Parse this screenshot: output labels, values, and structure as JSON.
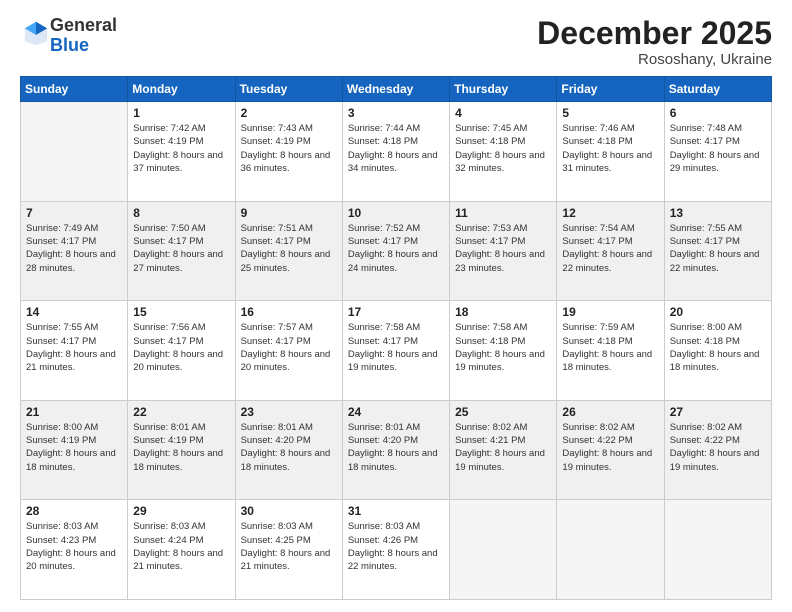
{
  "header": {
    "logo_general": "General",
    "logo_blue": "Blue",
    "month_title": "December 2025",
    "location": "Rososhany, Ukraine"
  },
  "calendar": {
    "days_of_week": [
      "Sunday",
      "Monday",
      "Tuesday",
      "Wednesday",
      "Thursday",
      "Friday",
      "Saturday"
    ],
    "weeks": [
      [
        {
          "day": "",
          "empty": true
        },
        {
          "day": "1",
          "sunrise": "7:42 AM",
          "sunset": "4:19 PM",
          "daylight": "8 hours and 37 minutes."
        },
        {
          "day": "2",
          "sunrise": "7:43 AM",
          "sunset": "4:19 PM",
          "daylight": "8 hours and 36 minutes."
        },
        {
          "day": "3",
          "sunrise": "7:44 AM",
          "sunset": "4:18 PM",
          "daylight": "8 hours and 34 minutes."
        },
        {
          "day": "4",
          "sunrise": "7:45 AM",
          "sunset": "4:18 PM",
          "daylight": "8 hours and 32 minutes."
        },
        {
          "day": "5",
          "sunrise": "7:46 AM",
          "sunset": "4:18 PM",
          "daylight": "8 hours and 31 minutes."
        },
        {
          "day": "6",
          "sunrise": "7:48 AM",
          "sunset": "4:17 PM",
          "daylight": "8 hours and 29 minutes."
        }
      ],
      [
        {
          "day": "7",
          "sunrise": "7:49 AM",
          "sunset": "4:17 PM",
          "daylight": "8 hours and 28 minutes."
        },
        {
          "day": "8",
          "sunrise": "7:50 AM",
          "sunset": "4:17 PM",
          "daylight": "8 hours and 27 minutes."
        },
        {
          "day": "9",
          "sunrise": "7:51 AM",
          "sunset": "4:17 PM",
          "daylight": "8 hours and 25 minutes."
        },
        {
          "day": "10",
          "sunrise": "7:52 AM",
          "sunset": "4:17 PM",
          "daylight": "8 hours and 24 minutes."
        },
        {
          "day": "11",
          "sunrise": "7:53 AM",
          "sunset": "4:17 PM",
          "daylight": "8 hours and 23 minutes."
        },
        {
          "day": "12",
          "sunrise": "7:54 AM",
          "sunset": "4:17 PM",
          "daylight": "8 hours and 22 minutes."
        },
        {
          "day": "13",
          "sunrise": "7:55 AM",
          "sunset": "4:17 PM",
          "daylight": "8 hours and 22 minutes."
        }
      ],
      [
        {
          "day": "14",
          "sunrise": "7:55 AM",
          "sunset": "4:17 PM",
          "daylight": "8 hours and 21 minutes."
        },
        {
          "day": "15",
          "sunrise": "7:56 AM",
          "sunset": "4:17 PM",
          "daylight": "8 hours and 20 minutes."
        },
        {
          "day": "16",
          "sunrise": "7:57 AM",
          "sunset": "4:17 PM",
          "daylight": "8 hours and 20 minutes."
        },
        {
          "day": "17",
          "sunrise": "7:58 AM",
          "sunset": "4:17 PM",
          "daylight": "8 hours and 19 minutes."
        },
        {
          "day": "18",
          "sunrise": "7:58 AM",
          "sunset": "4:18 PM",
          "daylight": "8 hours and 19 minutes."
        },
        {
          "day": "19",
          "sunrise": "7:59 AM",
          "sunset": "4:18 PM",
          "daylight": "8 hours and 18 minutes."
        },
        {
          "day": "20",
          "sunrise": "8:00 AM",
          "sunset": "4:18 PM",
          "daylight": "8 hours and 18 minutes."
        }
      ],
      [
        {
          "day": "21",
          "sunrise": "8:00 AM",
          "sunset": "4:19 PM",
          "daylight": "8 hours and 18 minutes."
        },
        {
          "day": "22",
          "sunrise": "8:01 AM",
          "sunset": "4:19 PM",
          "daylight": "8 hours and 18 minutes."
        },
        {
          "day": "23",
          "sunrise": "8:01 AM",
          "sunset": "4:20 PM",
          "daylight": "8 hours and 18 minutes."
        },
        {
          "day": "24",
          "sunrise": "8:01 AM",
          "sunset": "4:20 PM",
          "daylight": "8 hours and 18 minutes."
        },
        {
          "day": "25",
          "sunrise": "8:02 AM",
          "sunset": "4:21 PM",
          "daylight": "8 hours and 19 minutes."
        },
        {
          "day": "26",
          "sunrise": "8:02 AM",
          "sunset": "4:22 PM",
          "daylight": "8 hours and 19 minutes."
        },
        {
          "day": "27",
          "sunrise": "8:02 AM",
          "sunset": "4:22 PM",
          "daylight": "8 hours and 19 minutes."
        }
      ],
      [
        {
          "day": "28",
          "sunrise": "8:03 AM",
          "sunset": "4:23 PM",
          "daylight": "8 hours and 20 minutes."
        },
        {
          "day": "29",
          "sunrise": "8:03 AM",
          "sunset": "4:24 PM",
          "daylight": "8 hours and 21 minutes."
        },
        {
          "day": "30",
          "sunrise": "8:03 AM",
          "sunset": "4:25 PM",
          "daylight": "8 hours and 21 minutes."
        },
        {
          "day": "31",
          "sunrise": "8:03 AM",
          "sunset": "4:26 PM",
          "daylight": "8 hours and 22 minutes."
        },
        {
          "day": "",
          "empty": true
        },
        {
          "day": "",
          "empty": true
        },
        {
          "day": "",
          "empty": true
        }
      ]
    ]
  }
}
